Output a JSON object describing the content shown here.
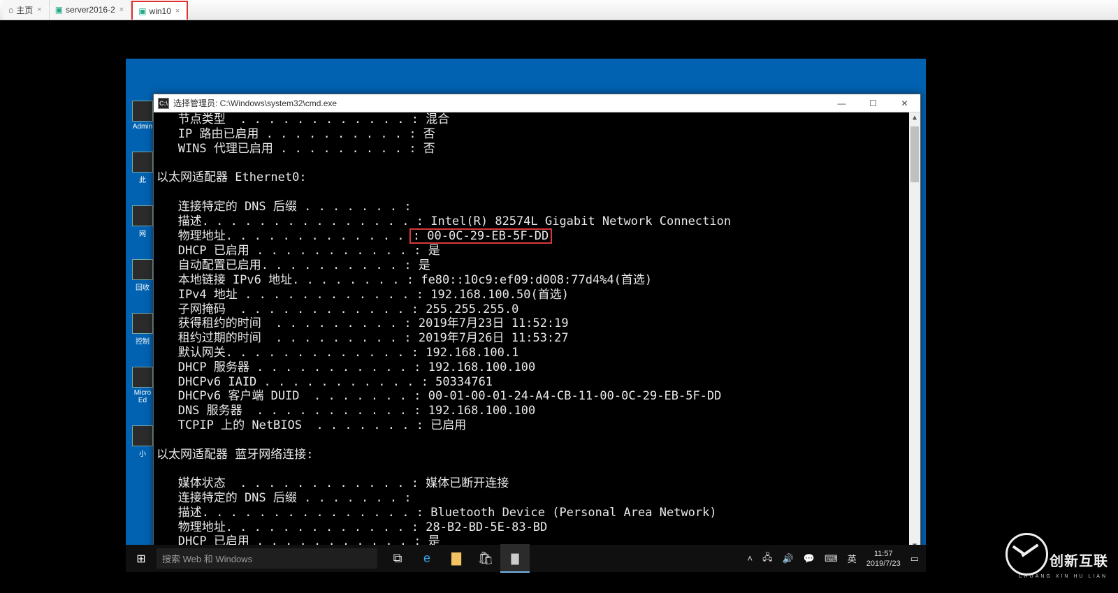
{
  "outer_tabs": {
    "home": "主页",
    "server": "server2016-2",
    "win10": "win10"
  },
  "cmd": {
    "title": "选择管理员: C:\\Windows\\system32\\cmd.exe",
    "lines_top": [
      "   节点类型  . . . . . . . . . . . . : 混合",
      "   IP 路由已启用 . . . . . . . . . . : 否",
      "   WINS 代理已启用 . . . . . . . . . : 否",
      "",
      "以太网适配器 Ethernet0:",
      "",
      "   连接特定的 DNS 后缀 . . . . . . . :",
      "   描述. . . . . . . . . . . . . . . : Intel(R) 82574L Gigabit Network Connection"
    ],
    "mac_label": "   物理地址. . . . . . . . . . . . . ",
    "mac_value": ": 00-0C-29-EB-5F-DD",
    "lines_after": [
      "   DHCP 已启用 . . . . . . . . . . . : 是",
      "   自动配置已启用. . . . . . . . . . : 是",
      "   本地链接 IPv6 地址. . . . . . . . : fe80::10c9:ef09:d008:77d4%4(首选)",
      "   IPv4 地址 . . . . . . . . . . . . : 192.168.100.50(首选)",
      "   子网掩码  . . . . . . . . . . . . : 255.255.255.0",
      "   获得租约的时间  . . . . . . . . . : 2019年7月23日 11:52:19",
      "   租约过期的时间  . . . . . . . . . : 2019年7月26日 11:53:27",
      "   默认网关. . . . . . . . . . . . . : 192.168.100.1",
      "   DHCP 服务器 . . . . . . . . . . . : 192.168.100.100",
      "   DHCPv6 IAID . . . . . . . . . . . : 50334761",
      "   DHCPv6 客户端 DUID  . . . . . . . : 00-01-00-01-24-A4-CB-11-00-0C-29-EB-5F-DD",
      "   DNS 服务器  . . . . . . . . . . . : 192.168.100.100",
      "   TCPIP 上的 NetBIOS  . . . . . . . : 已启用",
      "",
      "以太网适配器 蓝牙网络连接:",
      "",
      "   媒体状态  . . . . . . . . . . . . : 媒体已断开连接",
      "   连接特定的 DNS 后缀 . . . . . . . :",
      "   描述. . . . . . . . . . . . . . . : Bluetooth Device (Personal Area Network)",
      "   物理地址. . . . . . . . . . . . . : 28-B2-BD-5E-83-BD",
      "   DHCP 已启用 . . . . . . . . . . . : 是"
    ]
  },
  "desktop": {
    "icons": [
      "Admin",
      "此",
      "网",
      "回收",
      "控制",
      "Micro Ed",
      "小"
    ]
  },
  "taskbar": {
    "search_placeholder": "搜索 Web 和 Windows",
    "ime": "英",
    "time": "11:57",
    "date": "2019/7/23"
  },
  "watermark": {
    "brand": "创新互联",
    "sub": "CHUANG XIN HU LIAN"
  }
}
